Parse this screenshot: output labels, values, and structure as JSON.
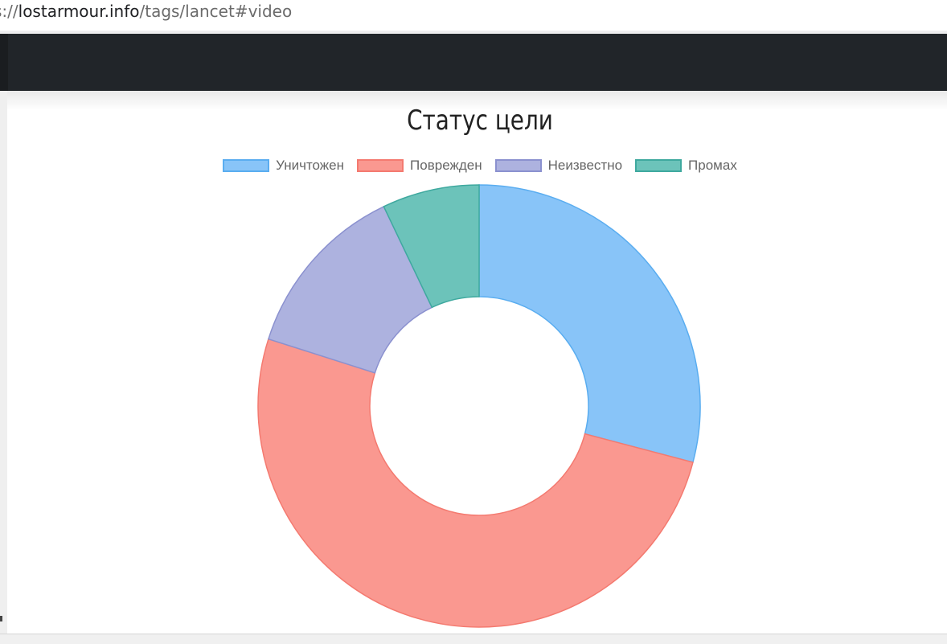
{
  "browser": {
    "url_prefix": "s://",
    "url_host": "lostarmour.info",
    "url_path": "/tags/lancet#video"
  },
  "chart_data": {
    "type": "pie",
    "title": "Статус цели",
    "legend_position": "top",
    "donut": true,
    "categories": [
      "Уничтожен",
      "Поврежден",
      "Неизвестно",
      "Промах"
    ],
    "values": [
      29.1,
      50.8,
      13.0,
      7.1
    ],
    "colors": [
      "#88c4f8",
      "#fa9890",
      "#adb2df",
      "#6cc3ba"
    ],
    "border_colors": [
      "#5aadf0",
      "#f47a70",
      "#8b91cf",
      "#3fa99f"
    ]
  }
}
